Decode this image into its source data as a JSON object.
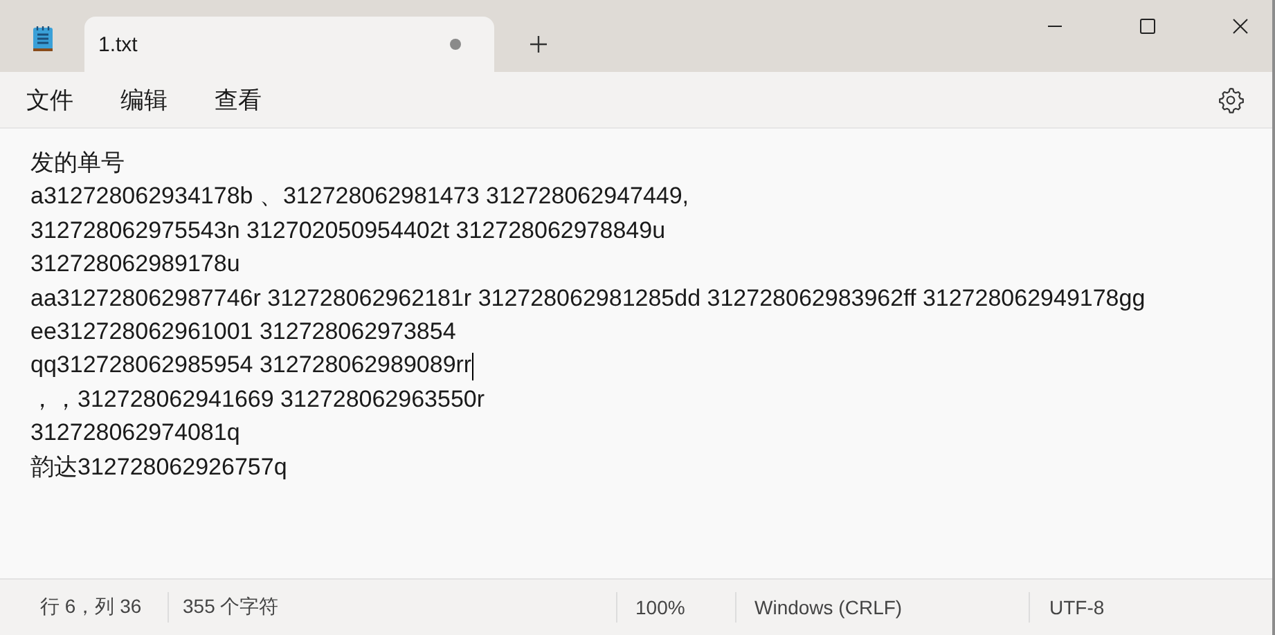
{
  "tab": {
    "title": "1.txt",
    "modified": true,
    "selected": true
  },
  "menu": [
    "文件",
    "编辑",
    "查看"
  ],
  "lines": [
    {
      "text": "发的单号",
      "caret": false
    },
    {
      "text": "a312728062934178b 、312728062981473 312728062947449,",
      "caret": false
    },
    {
      "text": "312728062975543n 312702050954402t 312728062978849u",
      "caret": false
    },
    {
      "text": "312728062989178u",
      "caret": false
    },
    {
      "text": "aa312728062987746r 312728062962181r 312728062981285dd 312728062983962ff 312728062949178gg",
      "caret": false
    },
    {
      "text": "ee312728062961001 312728062973854",
      "caret": false
    },
    {
      "text": "qq312728062985954 312728062989089rr",
      "caret": true
    },
    {
      "text": "，，312728062941669 312728062963550r",
      "caret": false
    },
    {
      "text": "312728062974081q",
      "caret": false
    },
    {
      "text": "韵达312728062926757q",
      "caret": false
    }
  ],
  "status_bar": {
    "position": "行 6，列 36",
    "characters": "355 个字符",
    "zoom": "100%",
    "line_ending": "Windows (CRLF)",
    "encoding": "UTF-8"
  }
}
